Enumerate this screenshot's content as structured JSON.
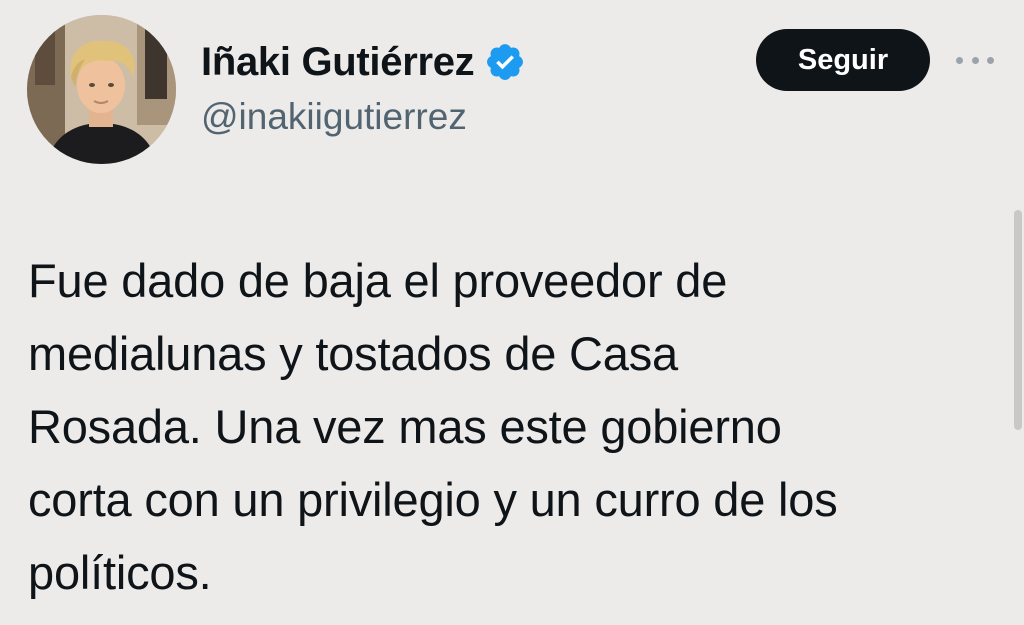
{
  "user": {
    "display_name": "Iñaki Gutiérrez",
    "handle": "@inakiigutierrez",
    "verified": true,
    "verified_icon": "verified-badge-icon",
    "verified_color": "#1d9bf0",
    "avatar_icon": "profile-photo"
  },
  "actions": {
    "follow_label": "Seguir",
    "more_icon": "more-options-icon"
  },
  "tweet": {
    "lines": [
      "Fue dado de baja el proveedor de",
      "medialunas y tostados de Casa",
      "Rosada. Una vez mas este gobierno",
      "corta con un privilegio y un curro de los",
      "políticos."
    ]
  },
  "colors": {
    "background": "#ecebea",
    "text": "#0f1419",
    "handle": "#536471",
    "button_bg": "#0f1419",
    "button_text": "#ffffff"
  }
}
